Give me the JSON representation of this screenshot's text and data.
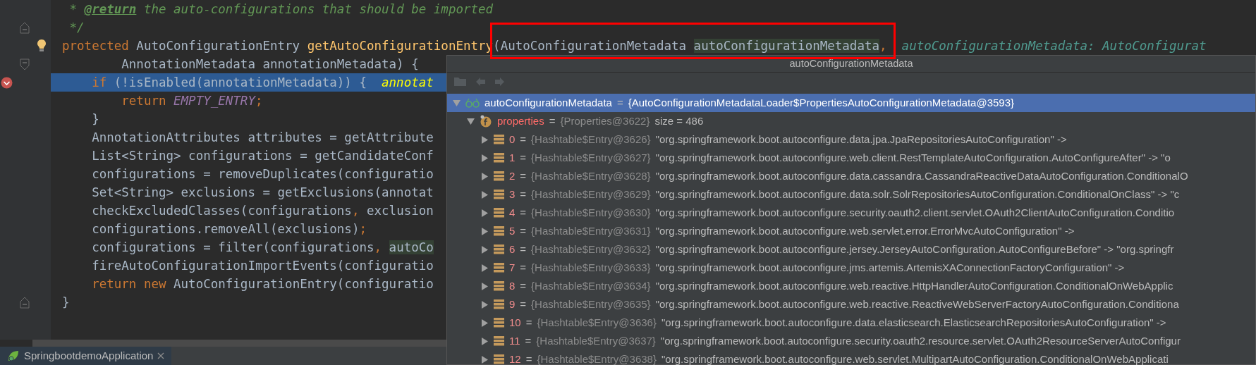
{
  "editor": {
    "lines": [
      {
        "executing": false,
        "segments": [
          {
            "text": " * ",
            "kind": "comment"
          },
          {
            "text": "@return",
            "kind": "doctag"
          },
          {
            "text": " the auto-configurations that should be imported",
            "kind": "comment"
          }
        ]
      },
      {
        "gutter": {
          "kind": "fold-end"
        },
        "executing": false,
        "segments": [
          {
            "text": " */",
            "kind": "comment"
          }
        ]
      },
      {
        "gutter": {
          "kind": "bulb"
        },
        "executing": false,
        "segments": [
          {
            "text": "protected",
            "kind": "keyword"
          },
          {
            "text": " AutoConfigurationEntry ",
            "kind": "plain"
          },
          {
            "text": "getAutoConfigurationEntry",
            "kind": "method"
          },
          {
            "text": "(AutoConfigurationMetadata ",
            "kind": "plain"
          },
          {
            "text": "autoConfigurationMetadata",
            "kind": "param"
          },
          {
            "text": ",",
            "kind": "punct"
          },
          {
            "text": "  autoConfigurationMetadata: AutoConfigurat",
            "kind": "hint"
          }
        ]
      },
      {
        "gutter": {
          "kind": "fold-start"
        },
        "executing": false,
        "segments": [
          {
            "text": "        AnnotationMetadata annotationMetadata) {",
            "kind": "plain"
          }
        ]
      },
      {
        "gutter": {
          "kind": "breakpoint"
        },
        "executing": true,
        "segments": [
          {
            "text": "    if",
            "kind": "keyword"
          },
          {
            "text": " (!isEnabled(annotationMetadata)) {  ",
            "kind": "plain"
          },
          {
            "text": "annotat",
            "kind": "debug-value"
          }
        ]
      },
      {
        "executing": false,
        "segments": [
          {
            "text": "        return ",
            "kind": "keyword"
          },
          {
            "text": "EMPTY_ENTRY",
            "kind": "constant"
          },
          {
            "text": ";",
            "kind": "punct"
          }
        ]
      },
      {
        "executing": false,
        "segments": [
          {
            "text": "    }",
            "kind": "plain"
          }
        ]
      },
      {
        "executing": false,
        "segments": [
          {
            "text": "    AnnotationAttributes attributes = getAttribute",
            "kind": "plain"
          }
        ]
      },
      {
        "executing": false,
        "segments": [
          {
            "text": "    List<String> configurations = getCandidateConf",
            "kind": "plain"
          }
        ]
      },
      {
        "executing": false,
        "segments": [
          {
            "text": "    configurations = removeDuplicates(configuratio",
            "kind": "plain"
          }
        ]
      },
      {
        "executing": false,
        "segments": [
          {
            "text": "    Set<String> exclusions = getExclusions(annotat",
            "kind": "plain"
          }
        ]
      },
      {
        "executing": false,
        "segments": [
          {
            "text": "    checkExcludedClasses(configurations",
            "kind": "plain"
          },
          {
            "text": ",",
            "kind": "punct"
          },
          {
            "text": " exclusion",
            "kind": "plain"
          }
        ]
      },
      {
        "executing": false,
        "segments": [
          {
            "text": "    configurations.removeAll(exclusions)",
            "kind": "plain"
          },
          {
            "text": ";",
            "kind": "punct"
          }
        ]
      },
      {
        "executing": false,
        "segments": [
          {
            "text": "    configurations = filter(configurations",
            "kind": "plain"
          },
          {
            "text": ", ",
            "kind": "punct"
          },
          {
            "text": "autoCo",
            "kind": "param"
          }
        ]
      },
      {
        "executing": false,
        "segments": [
          {
            "text": "    fireAutoConfigurationImportEvents(configuratio",
            "kind": "plain"
          }
        ]
      },
      {
        "executing": false,
        "segments": [
          {
            "text": "    return new",
            "kind": "keyword"
          },
          {
            "text": " AutoConfigurationEntry(configuratio",
            "kind": "plain"
          }
        ]
      },
      {
        "gutter": {
          "kind": "fold-end"
        },
        "executing": false,
        "segments": [
          {
            "text": "}",
            "kind": "plain"
          }
        ]
      }
    ]
  },
  "popup": {
    "title": "autoConfigurationMetadata",
    "tree": [
      {
        "kind": "watch",
        "name": "autoConfigurationMetadata",
        "sep": "=",
        "type": "{AutoConfigurationMetadataLoader$PropertiesAutoConfigurationMetadata@3593}",
        "expanded": true,
        "selected": true,
        "children": [
          {
            "kind": "field",
            "name": "properties",
            "sep": "=",
            "type": "{Properties@3622}",
            "value": "size = 486",
            "expanded": true,
            "selected": false,
            "children": [
              {
                "kind": "entry",
                "name": "0",
                "sep": "=",
                "type": "{Hashtable$Entry@3626}",
                "value": "\"org.springframework.boot.autoconfigure.data.jpa.JpaRepositoriesAutoConfiguration\" ->",
                "expanded": false,
                "selected": false
              },
              {
                "kind": "entry",
                "name": "1",
                "sep": "=",
                "type": "{Hashtable$Entry@3627}",
                "value": "\"org.springframework.boot.autoconfigure.web.client.RestTemplateAutoConfiguration.AutoConfigureAfter\" -> \"o",
                "expanded": false,
                "selected": false
              },
              {
                "kind": "entry",
                "name": "2",
                "sep": "=",
                "type": "{Hashtable$Entry@3628}",
                "value": "\"org.springframework.boot.autoconfigure.data.cassandra.CassandraReactiveDataAutoConfiguration.ConditionalO",
                "expanded": false,
                "selected": false
              },
              {
                "kind": "entry",
                "name": "3",
                "sep": "=",
                "type": "{Hashtable$Entry@3629}",
                "value": "\"org.springframework.boot.autoconfigure.data.solr.SolrRepositoriesAutoConfiguration.ConditionalOnClass\" -> \"c",
                "expanded": false,
                "selected": false
              },
              {
                "kind": "entry",
                "name": "4",
                "sep": "=",
                "type": "{Hashtable$Entry@3630}",
                "value": "\"org.springframework.boot.autoconfigure.security.oauth2.client.servlet.OAuth2ClientAutoConfiguration.Conditio",
                "expanded": false,
                "selected": false
              },
              {
                "kind": "entry",
                "name": "5",
                "sep": "=",
                "type": "{Hashtable$Entry@3631}",
                "value": "\"org.springframework.boot.autoconfigure.web.servlet.error.ErrorMvcAutoConfiguration\" ->",
                "expanded": false,
                "selected": false
              },
              {
                "kind": "entry",
                "name": "6",
                "sep": "=",
                "type": "{Hashtable$Entry@3632}",
                "value": "\"org.springframework.boot.autoconfigure.jersey.JerseyAutoConfiguration.AutoConfigureBefore\" -> \"org.springfr",
                "expanded": false,
                "selected": false
              },
              {
                "kind": "entry",
                "name": "7",
                "sep": "=",
                "type": "{Hashtable$Entry@3633}",
                "value": "\"org.springframework.boot.autoconfigure.jms.artemis.ArtemisXAConnectionFactoryConfiguration\" ->",
                "expanded": false,
                "selected": false
              },
              {
                "kind": "entry",
                "name": "8",
                "sep": "=",
                "type": "{Hashtable$Entry@3634}",
                "value": "\"org.springframework.boot.autoconfigure.web.reactive.HttpHandlerAutoConfiguration.ConditionalOnWebApplic",
                "expanded": false,
                "selected": false
              },
              {
                "kind": "entry",
                "name": "9",
                "sep": "=",
                "type": "{Hashtable$Entry@3635}",
                "value": "\"org.springframework.boot.autoconfigure.web.reactive.ReactiveWebServerFactoryAutoConfiguration.Conditiona",
                "expanded": false,
                "selected": false
              },
              {
                "kind": "entry",
                "name": "10",
                "sep": "=",
                "type": "{Hashtable$Entry@3636}",
                "value": "\"org.springframework.boot.autoconfigure.data.elasticsearch.ElasticsearchRepositoriesAutoConfiguration\" ->",
                "expanded": false,
                "selected": false
              },
              {
                "kind": "entry",
                "name": "11",
                "sep": "=",
                "type": "{Hashtable$Entry@3637}",
                "value": "\"org.springframework.boot.autoconfigure.security.oauth2.resource.servlet.OAuth2ResourceServerAutoConfigur",
                "expanded": false,
                "selected": false
              },
              {
                "kind": "entry",
                "name": "12",
                "sep": "=",
                "type": "{Hashtable$Entry@3638}",
                "value": "\"org.springframework.boot.autoconfigure.web.servlet.MultipartAutoConfiguration.ConditionalOnWebApplicati",
                "expanded": false,
                "selected": false
              }
            ]
          }
        ]
      }
    ]
  },
  "run_tabs": [
    {
      "label": "SpringbootdemoApplication",
      "selected": true
    }
  ]
}
